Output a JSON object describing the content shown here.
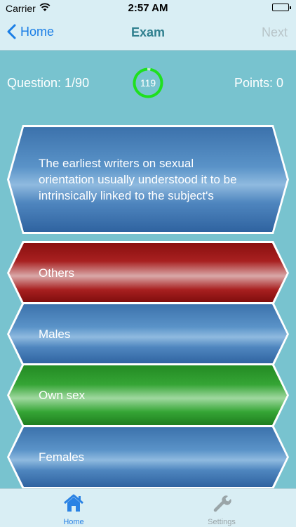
{
  "status_bar": {
    "carrier": "Carrier",
    "time": "2:57 AM"
  },
  "nav": {
    "back_label": "Home",
    "title": "Exam",
    "next_label": "Next"
  },
  "info": {
    "question_counter": "Question: 1/90",
    "timer": "119",
    "points": "Points: 0"
  },
  "question": {
    "text": "The earliest writers on sexual orientation usually understood it to be intrinsically linked to the subject's"
  },
  "answers": [
    {
      "label": "Others",
      "color": "#a82020"
    },
    {
      "label": "Males",
      "color": "#3c72ac"
    },
    {
      "label": "Own sex",
      "color": "#35a535"
    },
    {
      "label": "Females",
      "color": "#3c72ac"
    }
  ],
  "tabs": [
    {
      "label": "Home",
      "icon": "house-icon",
      "active": true
    },
    {
      "label": "Settings",
      "icon": "wrench-icon",
      "active": false
    }
  ],
  "colors": {
    "background": "#78c3cf",
    "bar": "#d9eef4",
    "accent": "#1a7ee6",
    "timer_ring": "#1fe01f"
  }
}
